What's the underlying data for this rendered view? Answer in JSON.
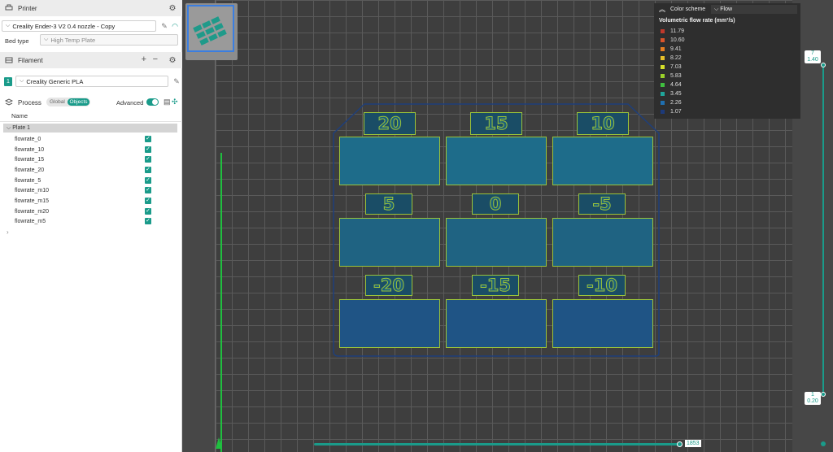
{
  "printer": {
    "section_title": "Printer",
    "preset": "Creality Ender-3 V2 0.4 nozzle - Copy",
    "bed_type_label": "Bed type",
    "bed_type_value": "High Temp Plate"
  },
  "filament": {
    "section_title": "Filament",
    "slot_number": "1",
    "preset": "Creality Generic PLA"
  },
  "process": {
    "section_title": "Process",
    "toggle_global": "Global",
    "toggle_objects": "Objects",
    "advanced_label": "Advanced"
  },
  "objects": {
    "column_name": "Name",
    "plate": "Plate 1",
    "items": [
      {
        "name": "flowrate_0"
      },
      {
        "name": "flowrate_10"
      },
      {
        "name": "flowrate_15"
      },
      {
        "name": "flowrate_20"
      },
      {
        "name": "flowrate_5"
      },
      {
        "name": "flowrate_m10"
      },
      {
        "name": "flowrate_m15"
      },
      {
        "name": "flowrate_m20"
      },
      {
        "name": "flowrate_m5"
      }
    ]
  },
  "color_scheme": {
    "label": "Color scheme",
    "value": "Flow",
    "legend_title": "Volumetric flow rate (mm³/s)",
    "legend": [
      {
        "value": "11.79",
        "color": "#c0392b"
      },
      {
        "value": "10.60",
        "color": "#d9542b"
      },
      {
        "value": "9.41",
        "color": "#e67e22"
      },
      {
        "value": "8.22",
        "color": "#e9c12a"
      },
      {
        "value": "7.03",
        "color": "#d7e02a"
      },
      {
        "value": "5.83",
        "color": "#9bd12a"
      },
      {
        "value": "4.64",
        "color": "#3fbf3f"
      },
      {
        "value": "3.45",
        "color": "#1fa59a"
      },
      {
        "value": "2.26",
        "color": "#1f6fb0"
      },
      {
        "value": "1.07",
        "color": "#1d3a7a"
      }
    ]
  },
  "model_labels": [
    {
      "text": "20"
    },
    {
      "text": "15"
    },
    {
      "text": "10"
    },
    {
      "text": "5"
    },
    {
      "text": "0"
    },
    {
      "text": "-5"
    },
    {
      "text": "-20"
    },
    {
      "text": "-15"
    },
    {
      "text": "-10"
    }
  ],
  "layer_slider": {
    "top_layer": "7",
    "top_height": "1.40",
    "bottom_layer": "1",
    "bottom_height": "0.20"
  },
  "move_slider": {
    "value": "1853"
  },
  "colors": {
    "accent": "#1a9b8a",
    "tile_fill": "#1a5f7a",
    "tile_edge": "#9bc43a",
    "outline": "#1f3f7a"
  }
}
